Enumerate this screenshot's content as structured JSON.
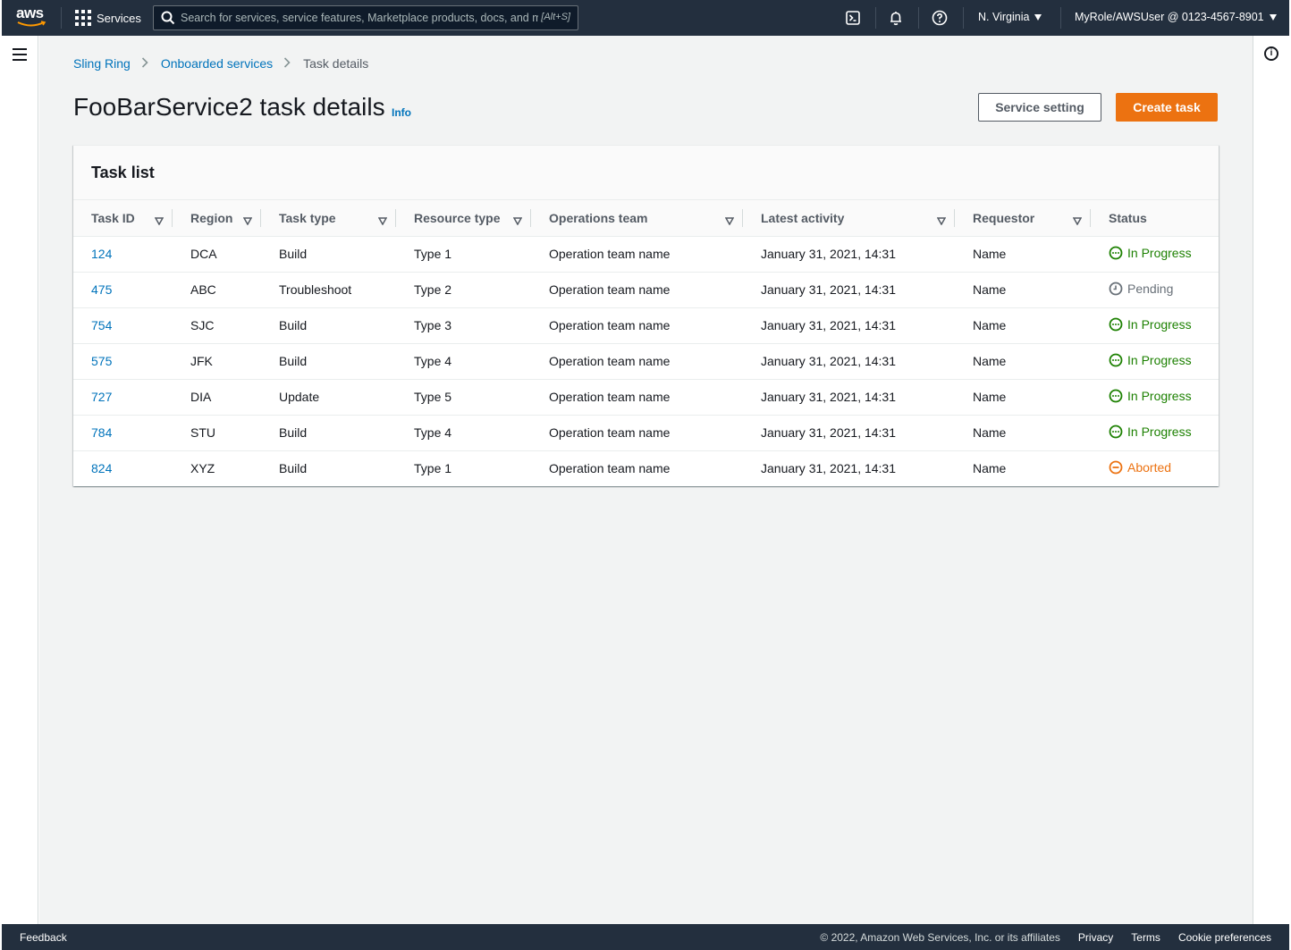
{
  "topnav": {
    "logo_text": "aws",
    "services_label": "Services",
    "search_placeholder": "Search for services, service features, Marketplace products, docs, and more",
    "search_hint": "[Alt+S]",
    "region_label": "N. Virginia",
    "account_label": "MyRole/AWSUser @ 0123-4567-8901"
  },
  "breadcrumb": {
    "items": [
      "Sling Ring",
      "Onboarded services"
    ],
    "current": "Task details"
  },
  "header": {
    "title": "FooBarService2 task details",
    "info_label": "Info",
    "service_setting_label": "Service setting",
    "create_task_label": "Create task"
  },
  "task_list": {
    "title": "Task list",
    "columns": [
      "Task ID",
      "Region",
      "Task type",
      "Resource type",
      "Operations team",
      "Latest activity",
      "Requestor",
      "Status"
    ],
    "rows": [
      {
        "task_id": "124",
        "region": "DCA",
        "task_type": "Build",
        "resource_type": "Type 1",
        "operations_team": "Operation team name",
        "latest_activity": "January 31, 2021, 14:31",
        "requestor": "Name",
        "status": "In Progress",
        "status_kind": "in-progress"
      },
      {
        "task_id": "475",
        "region": "ABC",
        "task_type": "Troubleshoot",
        "resource_type": "Type 2",
        "operations_team": "Operation team name",
        "latest_activity": "January 31, 2021, 14:31",
        "requestor": "Name",
        "status": "Pending",
        "status_kind": "pending"
      },
      {
        "task_id": "754",
        "region": "SJC",
        "task_type": "Build",
        "resource_type": "Type 3",
        "operations_team": "Operation team name",
        "latest_activity": "January 31, 2021, 14:31",
        "requestor": "Name",
        "status": "In Progress",
        "status_kind": "in-progress"
      },
      {
        "task_id": "575",
        "region": "JFK",
        "task_type": "Build",
        "resource_type": "Type 4",
        "operations_team": "Operation team name",
        "latest_activity": "January 31, 2021, 14:31",
        "requestor": "Name",
        "status": "In Progress",
        "status_kind": "in-progress"
      },
      {
        "task_id": "727",
        "region": "DIA",
        "task_type": "Update",
        "resource_type": "Type 5",
        "operations_team": "Operation team name",
        "latest_activity": "January 31, 2021, 14:31",
        "requestor": "Name",
        "status": "In Progress",
        "status_kind": "in-progress"
      },
      {
        "task_id": "784",
        "region": "STU",
        "task_type": "Build",
        "resource_type": "Type 4",
        "operations_team": "Operation team name",
        "latest_activity": "January 31, 2021, 14:31",
        "requestor": "Name",
        "status": "In Progress",
        "status_kind": "in-progress"
      },
      {
        "task_id": "824",
        "region": "XYZ",
        "task_type": "Build",
        "resource_type": "Type 1",
        "operations_team": "Operation team name",
        "latest_activity": "January 31, 2021, 14:31",
        "requestor": "Name",
        "status": "Aborted",
        "status_kind": "aborted"
      }
    ]
  },
  "status_colors": {
    "in-progress": "#1d8102",
    "pending": "#687078",
    "aborted": "#ec7211"
  },
  "footer": {
    "feedback_label": "Feedback",
    "copyright": "© 2022, Amazon Web Services, Inc. or its affiliates",
    "privacy_label": "Privacy",
    "terms_label": "Terms",
    "cookie_label": "Cookie preferences"
  },
  "colors": {
    "nav_bg": "#232f3e",
    "accent": "#ec7211",
    "link": "#0073bb"
  }
}
